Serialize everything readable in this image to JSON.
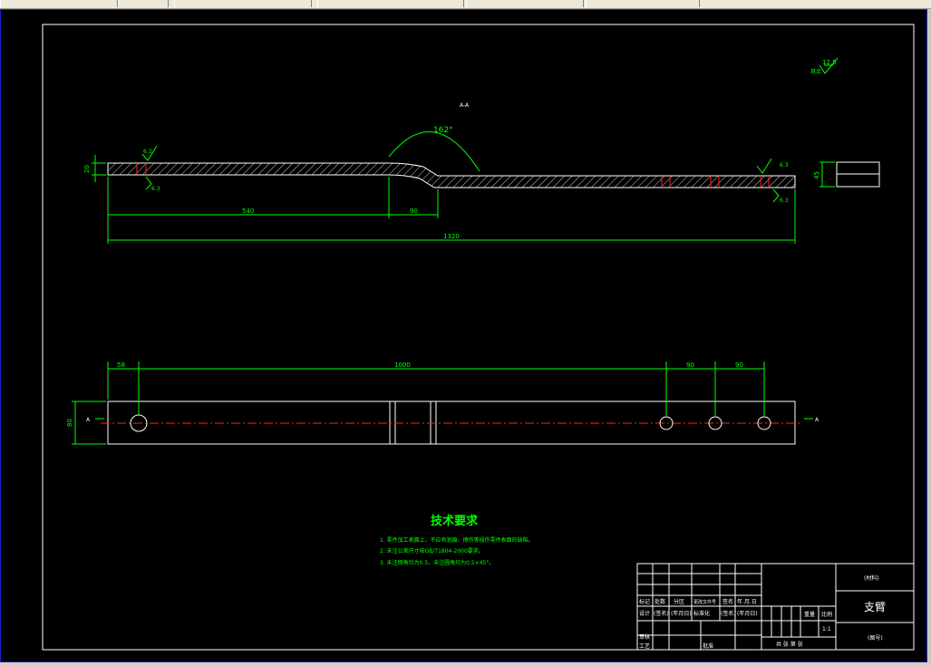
{
  "toolbar": {
    "segments": [
      "",
      "",
      "",
      "",
      "",
      ""
    ]
  },
  "drawing": {
    "section_label": "A-A",
    "roughness_top": "12.5",
    "roughness_top_note": "其余",
    "roughness_left_top": "6.3",
    "roughness_left_bottom": "6.3",
    "roughness_right_top": "6.3",
    "roughness_right_bottom": "6.3",
    "angle": "162°",
    "dim_thickness": "20",
    "dim_540": "540",
    "dim_90_bend": "90",
    "dim_1320": "1320",
    "dim_end_view": "45",
    "dim_58": "58",
    "dim_1000": "1000",
    "dim_90_a": "90",
    "dim_90_b": "90",
    "dim_80": "80",
    "section_mark_left": "A",
    "section_mark_right": "A"
  },
  "tech_requirements": {
    "title": "技术要求",
    "items": [
      "1. 零件加工表面上，不应有划痕、擦伤等损伤零件表面的缺陷。",
      "2. 未注公差尺寸按GB/T1804-2000要求。",
      "3. 未注倒角均为0.5，未注圆角均为0.5×45°。"
    ]
  },
  "title_block": {
    "material": "(材料)",
    "part_name": "支臂",
    "drawing_no": "(图号)",
    "weight_label": "重量",
    "scale_label": "比例",
    "scale_value": "1:1",
    "sheets_label": "共 张 第 张",
    "row_mark": "标记",
    "row_count": "处数",
    "row_zone": "分区",
    "row_change_doc": "更改文件号",
    "row_sign": "签名",
    "row_date": "年.月.日",
    "designer": "设计",
    "designer_sign": "(签名)",
    "designer_date": "(年月日)",
    "standardize": "标准化",
    "std_sign": "(签名)",
    "std_date": "(年月日)",
    "review": "审核",
    "process": "工艺",
    "approve": "批准"
  }
}
